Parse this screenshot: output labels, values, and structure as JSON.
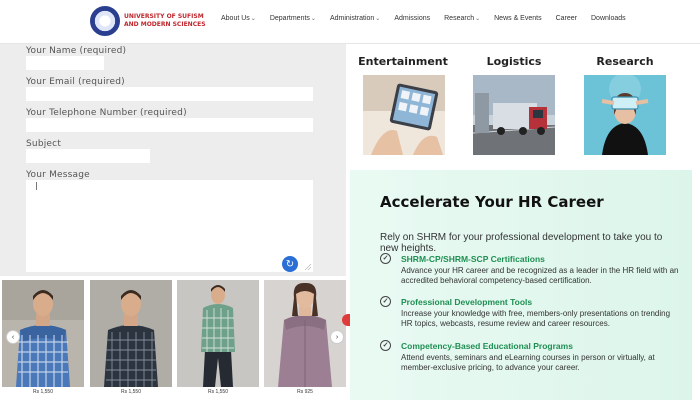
{
  "header": {
    "logo_line1": "UNIVERSITY OF SUFISM",
    "logo_line2": "AND MODERN SCIENCES",
    "nav": [
      {
        "label": "About Us",
        "dropdown": true
      },
      {
        "label": "Departments",
        "dropdown": true
      },
      {
        "label": "Administration",
        "dropdown": true
      },
      {
        "label": "Admissions",
        "dropdown": false
      },
      {
        "label": "Research",
        "dropdown": true
      },
      {
        "label": "News & Events",
        "dropdown": false
      },
      {
        "label": "Career",
        "dropdown": false
      },
      {
        "label": "Downloads",
        "dropdown": false
      }
    ]
  },
  "form": {
    "name_label": "Your Name (required)",
    "email_label": "Your Email (required)",
    "phone_label": "Your Telephone Number (required)",
    "subject_label": "Subject",
    "message_label": "Your Message"
  },
  "carousel": {
    "prev_icon": "chevron-left-icon",
    "next_icon": "chevron-right-icon",
    "products": [
      {
        "price": "Rs 1,550"
      },
      {
        "price": "Rs 1,550"
      },
      {
        "price": "Rs 1,550"
      },
      {
        "price": "Rs 925"
      }
    ]
  },
  "tiles": [
    {
      "title": "Entertainment"
    },
    {
      "title": "Logistics"
    },
    {
      "title": "Research"
    }
  ],
  "ad": {
    "title": "Accelerate Your HR Career",
    "intro": "Rely on SHRM for your professional development to take you to new heights.",
    "items": [
      {
        "head": "SHRM-CP/SHRM-SCP Certifications",
        "body": "Advance your HR career and be recognized as a leader in the HR field with an accredited behavioral competency-based certification."
      },
      {
        "head": "Professional Development Tools",
        "body": "Increase your knowledge with free, members-only presentations on trending HR topics, webcasts, resume review and career resources."
      },
      {
        "head": "Competency-Based Educational Programs",
        "body": "Attend events, seminars and eLearning courses in person or virtually, at member-exclusive pricing, to advance your career."
      }
    ],
    "accent_color": "#1e8f52"
  }
}
